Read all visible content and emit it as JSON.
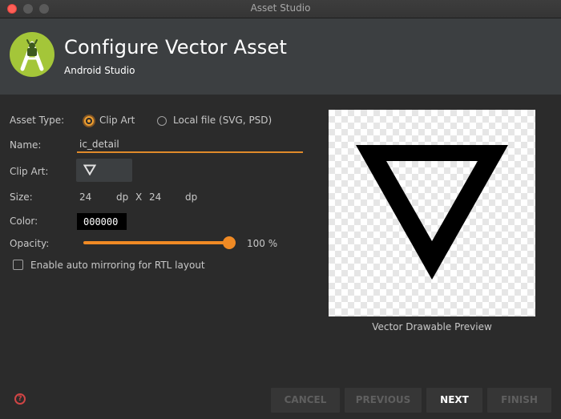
{
  "window": {
    "title": "Asset Studio"
  },
  "header": {
    "title": "Configure Vector Asset",
    "subtitle": "Android Studio"
  },
  "form": {
    "asset_type": {
      "label": "Asset Type:",
      "options": [
        {
          "label": "Clip Art",
          "selected": true
        },
        {
          "label": "Local file (SVG, PSD)",
          "selected": false
        }
      ]
    },
    "name": {
      "label": "Name:",
      "value": "ic_detail"
    },
    "clip_art": {
      "label": "Clip Art:",
      "icon": "triangle-down-outline-icon"
    },
    "size": {
      "label": "Size:",
      "width": "24",
      "height": "24",
      "unit": "dp",
      "separator": "X"
    },
    "color": {
      "label": "Color:",
      "value": "000000"
    },
    "opacity": {
      "label": "Opacity:",
      "value": 100,
      "display": "100 %"
    },
    "rtl": {
      "label": "Enable auto mirroring for RTL layout",
      "checked": false
    }
  },
  "preview": {
    "caption": "Vector Drawable Preview",
    "icon": "triangle-down-outline-icon",
    "color": "#000000"
  },
  "buttons": {
    "cancel": "CANCEL",
    "previous": "PREVIOUS",
    "next": "NEXT",
    "finish": "FINISH"
  },
  "colors": {
    "accent": "#f08a24",
    "background": "#2b2b2b",
    "header": "#3c3f41",
    "logo": "#a4c639"
  }
}
